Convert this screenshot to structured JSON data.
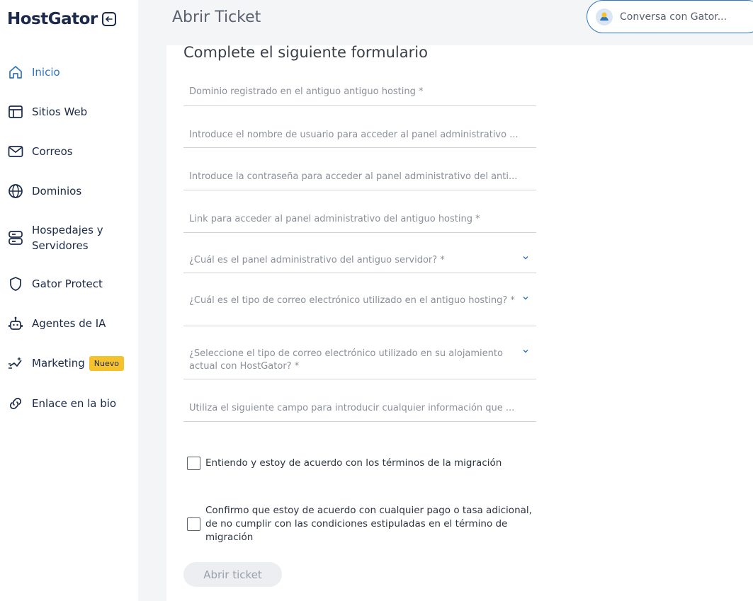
{
  "brand": {
    "logo_text": "HostGator"
  },
  "sidebar": {
    "items": [
      {
        "label": "Inicio",
        "icon": "home-icon",
        "active": true
      },
      {
        "label": "Sitios Web",
        "icon": "layout-icon"
      },
      {
        "label": "Correos",
        "icon": "mail-icon"
      },
      {
        "label": "Dominios",
        "icon": "globe-icon"
      },
      {
        "label": "Hospedajes y Servidores",
        "icon": "server-icon"
      },
      {
        "label": "Gator Protect",
        "icon": "shield-icon"
      },
      {
        "label": "Agentes de IA",
        "icon": "robot-icon"
      },
      {
        "label": "Marketing",
        "icon": "sparkle-rocket-icon",
        "badge": "Nuevo"
      },
      {
        "label": "Enlace en la bio",
        "icon": "link-icon"
      }
    ]
  },
  "header": {
    "title": "Abrir Ticket",
    "chat_label": "Conversa con Gator..."
  },
  "form": {
    "title": "Complete el siguiente formulario",
    "fields": [
      {
        "placeholder": "Dominio registrado en el antiguo antiguo hosting *"
      },
      {
        "placeholder": "Introduce el nombre de usuario para acceder al panel administrativo ..."
      },
      {
        "placeholder": "Introduce la contraseña para acceder al panel administrativo del anti..."
      },
      {
        "placeholder": "Link para acceder al panel administrativo del antiguo hosting *"
      },
      {
        "placeholder": "¿Cuál es el panel administrativo del antiguo servidor? *",
        "type": "select"
      },
      {
        "placeholder": "¿Cuál es el tipo de correo electrónico utilizado en el antiguo hosting? *",
        "type": "select"
      },
      {
        "placeholder": "¿Seleccione el tipo de correo electrónico utilizado en su alojamiento actual con HostGator? *",
        "type": "select"
      },
      {
        "placeholder": "Utiliza el siguiente campo para introducir cualquier información que ..."
      }
    ],
    "checkboxes": [
      {
        "label": "Entiendo y estoy de acuerdo con los términos de la migración",
        "checked": false
      },
      {
        "label": "Confirmo que estoy de acuerdo con cualquier pago o tasa adicional, de no cumplir con las condiciones estipuladas en el término de migración",
        "checked": false
      }
    ],
    "submit_label": "Abrir ticket"
  },
  "colors": {
    "accent": "#2f74c0",
    "navy": "#1b2a4a",
    "badge": "#f6c22c"
  }
}
